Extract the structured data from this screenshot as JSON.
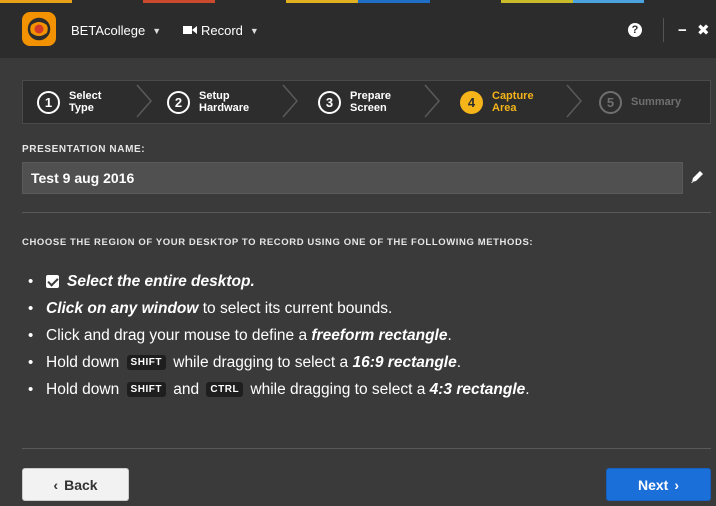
{
  "top_strip_colors": [
    "#e8a21a",
    "#2c2c2c",
    "#c94a2c",
    "#2c2c2c",
    "#e0b020",
    "#1f6fc7",
    "#2c2c2c",
    "#c9ba2a",
    "#4aa3df",
    "#2c2c2c"
  ],
  "titlebar": {
    "app_menu": "BETAcollege",
    "record_menu": "Record",
    "help_icon": "?",
    "minimize_icon": "−",
    "close_icon": "✖"
  },
  "steps": [
    {
      "num": "1",
      "label_line1": "Select",
      "label_line2": "Type",
      "state": "done"
    },
    {
      "num": "2",
      "label_line1": "Setup",
      "label_line2": "Hardware",
      "state": "done"
    },
    {
      "num": "3",
      "label_line1": "Prepare",
      "label_line2": "Screen",
      "state": "done"
    },
    {
      "num": "4",
      "label_line1": "Capture",
      "label_line2": "Area",
      "state": "active"
    },
    {
      "num": "5",
      "label_line1": "Summary",
      "label_line2": "",
      "state": "disabled"
    }
  ],
  "presentation": {
    "label": "PRESENTATION NAME:",
    "value": "Test 9 aug 2016"
  },
  "region": {
    "label": "CHOOSE THE REGION OF YOUR DESKTOP TO RECORD USING ONE OF THE FOLLOWING METHODS:",
    "m1_text": "Select the entire desktop.",
    "m2_bold": "Click on any window",
    "m2_rest": " to select its current bounds.",
    "m3_pre": "Click and drag your mouse to define a ",
    "m3_bold": "freeform rectangle",
    "m3_post": ".",
    "m4_pre": "Hold down ",
    "m4_key": "SHIFT",
    "m4_mid": " while dragging to select a ",
    "m4_bold": "16:9 rectangle",
    "m4_post": ".",
    "m5_pre": "Hold down ",
    "m5_key1": "SHIFT",
    "m5_and": " and ",
    "m5_key2": "CTRL",
    "m5_mid": " while dragging to select a ",
    "m5_bold": "4:3 rectangle",
    "m5_post": "."
  },
  "footer": {
    "back_label": "Back",
    "next_label": "Next"
  },
  "colors": {
    "accent": "#f4b41a",
    "primary_button": "#1a6fd8",
    "background": "#3a3a3a"
  }
}
